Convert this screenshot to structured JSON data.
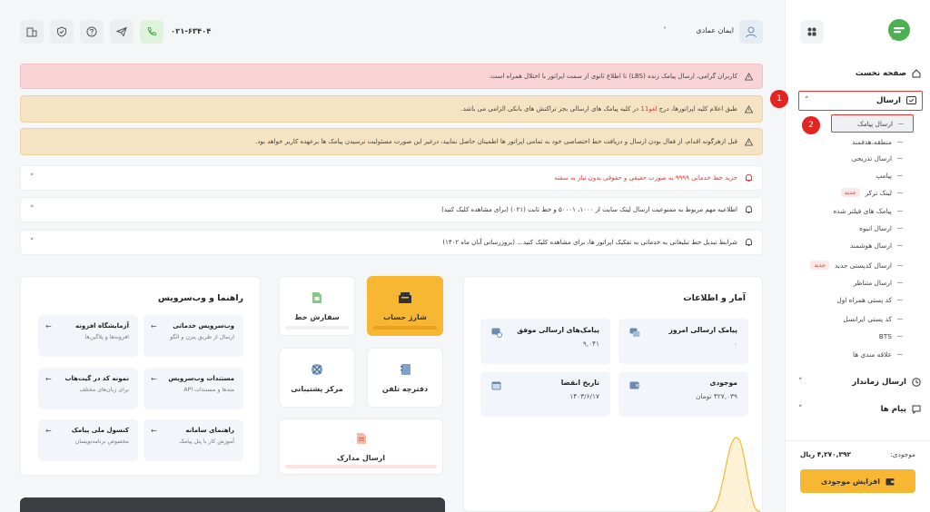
{
  "header": {
    "phone": "۰۲۱-۶۳۴۰۴",
    "user_name": "ایمان عمادی"
  },
  "alerts": [
    "کاربران گرامی، ارسال پیامک زنده (LBS) تا اطلاع ثانوی از سمت اپراتور با اختلال همراه است.",
    {
      "pre": "طبق اعلام کلیه اپراتورها، درج ",
      "hl": "لغو11",
      "post": " در کلیه پیامک های ارسالی بجز تراکنش های بانکی الزامی می باشد."
    },
    "قبل ازهرگونه اقدام، از فعال بودن ارسال و دریافت خط اختصاصی خود به تمامی اپراتور ها اطمینان حاصل نمایید، درغیر این صورت مسئولیت نرسیدن پیامک ها برعهده کاربر خواهد بود."
  ],
  "announcements": [
    "خرید خط خدماتی ۹۹۹۹ به صورت حقیقی و حقوقی بدون نیاز به سفته",
    "اطلاعیه مهم مربوط به ممنوعیت ارسال لینک سایت از ۱۰۰۰، ۵۰۰۰۱ و خط ثابت (۰۲۱) (برای مشاهده کلیک کنید)",
    "شرایط تبدیل خط تبلیغاتی به خدماتی به تفکیک اپراتور ها، برای مشاهده کلیک کنید... (بروزرسانی آبان ماه ۱۴۰۲)"
  ],
  "sidebar": {
    "home": "صفحه نخست",
    "send": "ارسال",
    "sub_items": [
      {
        "label": "ارسال پیامک"
      },
      {
        "label": "منطقه،هدفمند"
      },
      {
        "label": "ارسال تدریجی"
      },
      {
        "label": "پیامپ"
      },
      {
        "label": "لینک ترکر",
        "badge": "جدید"
      },
      {
        "label": "پیامک های فیلتر شده"
      },
      {
        "label": "ارسال انبوه"
      },
      {
        "label": "ارسال هوشمند"
      },
      {
        "label": "ارسال کدپستی جدید",
        "badge": "جدید"
      },
      {
        "label": "ارسال متناظر"
      },
      {
        "label": "کد پستی همراه اول"
      },
      {
        "label": "کد پستی ایرانسل"
      },
      {
        "label": "BTS"
      },
      {
        "label": "علاقه مندی ها"
      }
    ],
    "timed_send": "ارسال زماندار",
    "messages": "پیام ها",
    "balance_label": "موجودی:",
    "balance_value": "۴,۲۷۰,۳۹۲ ریال",
    "topup": "افزایش موجودی"
  },
  "markers": [
    "1",
    "2"
  ],
  "stats": {
    "title": "آمار و اطلاعات",
    "items": [
      {
        "label": "پیامک ارسالی امروز",
        "value": "۰"
      },
      {
        "label": "پیامک‌های ارسالی موفق",
        "value": "۹,۰۴۱"
      },
      {
        "label": "موجودی",
        "value": "۴۲۷,۰۳۹ تومان"
      },
      {
        "label": "تاریخ انقضا",
        "value": "۱۴۰۳/۶/۱۷"
      }
    ]
  },
  "tiles": {
    "charge": "شارژ حساب",
    "order": "سفارش خط",
    "phonebook": "دفترچه تلفن",
    "support": "مرکز پشتیبانی",
    "docs": "ارسال مدارک"
  },
  "guide": {
    "title": "راهنما و وب‌سرویس",
    "items": [
      {
        "title": "وب‌سرویس خدماتی",
        "desc": "ارسال از طریق پترن و الگو"
      },
      {
        "title": "آزمایشگاه افزونه",
        "desc": "افزونه‌ها و پلاگین‌ها"
      },
      {
        "title": "مستندات وب‌سرویس",
        "desc": "متدها و مستندات API"
      },
      {
        "title": "نمونه کد در گیت‌هاب",
        "desc": "برای زبان‌های مختلف"
      },
      {
        "title": "راهنمای سامانه",
        "desc": "آموزش کار با پنل پیامک"
      },
      {
        "title": "کنسول ملی پیامک",
        "desc": "مخصوص برنامه‌نویسان"
      }
    ]
  },
  "colors": {
    "accent": "#f7b733",
    "brand_green": "#4caf50",
    "alert_red": "#f8d4d6",
    "alert_yellow": "#f5e3c3",
    "marker": "#e32420"
  }
}
